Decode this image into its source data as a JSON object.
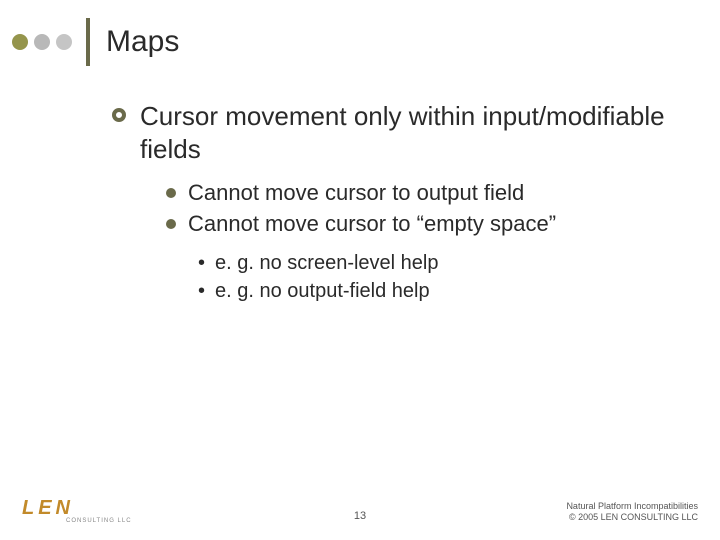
{
  "title": "Maps",
  "body": {
    "level1": "Cursor movement only within input/modifiable fields",
    "level2a": "Cannot move cursor to output field",
    "level2b": "Cannot move cursor to “empty space”",
    "level3a": "e. g. no screen-level help",
    "level3b": "e. g. no output-field help"
  },
  "footer": {
    "logo_main": "LEN",
    "logo_sub": "CONSULTING LLC",
    "page": "13",
    "line1": "Natural Platform Incompatibilities",
    "line2": "© 2005 LEN CONSULTING LLC"
  }
}
